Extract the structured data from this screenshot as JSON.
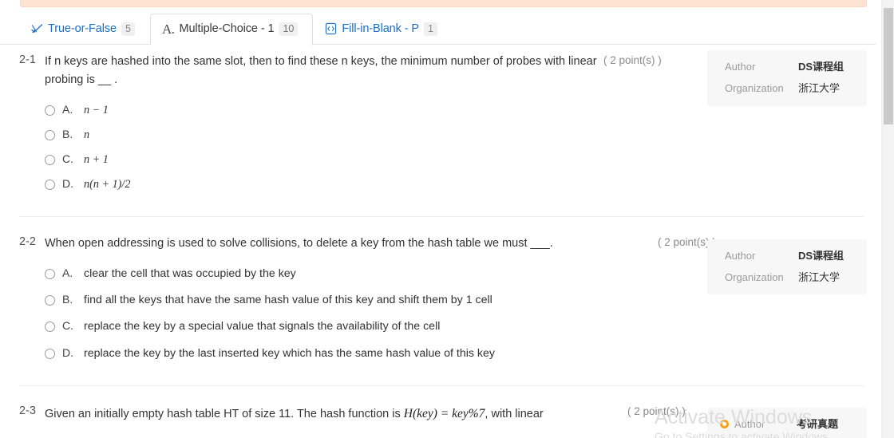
{
  "tabs": [
    {
      "icon": "true-false-icon",
      "label": "True-or-False",
      "badge": "5",
      "active": false
    },
    {
      "icon": "letter-a-icon",
      "label": "Multiple-Choice - 1",
      "badge": "10",
      "active": true
    },
    {
      "icon": "fill-in-blank-icon",
      "label": "Fill-in-Blank - P",
      "badge": "1",
      "active": false
    }
  ],
  "questions": [
    {
      "number": "2-1",
      "text_before": "If n keys are hashed into the same slot, then to find these n keys, the minimum number of probes with linear probing is ",
      "blank": "__",
      "text_after": " .",
      "points": "( 2 point(s) )",
      "options": [
        {
          "key": "A.",
          "math": "n − 1"
        },
        {
          "key": "B.",
          "math": "n"
        },
        {
          "key": "C.",
          "math": "n + 1"
        },
        {
          "key": "D.",
          "math": "n(n + 1)/2"
        }
      ],
      "author": {
        "author_label": "Author",
        "author_value": "DS课程组",
        "org_label": "Organization",
        "org_value": "浙江大学"
      }
    },
    {
      "number": "2-2",
      "text_before": "When open addressing is used to solve collisions, to delete a key from the hash table we must ",
      "blank": "___",
      "text_after": ".",
      "points": "( 2 point(s) )",
      "options": [
        {
          "key": "A.",
          "text": "clear the cell that was occupied by the key"
        },
        {
          "key": "B.",
          "text": "find all the keys that have the same hash value of this key and shift them by 1 cell"
        },
        {
          "key": "C.",
          "text": "replace the key by a special value that signals the availability of the cell"
        },
        {
          "key": "D.",
          "text": "replace the key by the last inserted key which has the same hash value of this key"
        }
      ],
      "author": {
        "author_label": "Author",
        "author_value": "DS课程组",
        "org_label": "Organization",
        "org_value": "浙江大学"
      }
    },
    {
      "number": "2-3",
      "text_before": "Given an initially empty hash table HT of size 11. The hash function is ",
      "formula": "H(key) = key%7",
      "text_after": ", with linear",
      "points": "( 2 point(s) )",
      "author": {
        "author_label": "Author",
        "author_value": "考研真题"
      }
    }
  ],
  "watermark": {
    "line1": "Activate Windows",
    "line2": "Go to Settings to activate Windows."
  },
  "colors": {
    "tab_link": "#1a6fc4",
    "banner": "#fde3d2",
    "card_bg": "#f7f7f7",
    "accent_dot": "#f7a21a"
  }
}
